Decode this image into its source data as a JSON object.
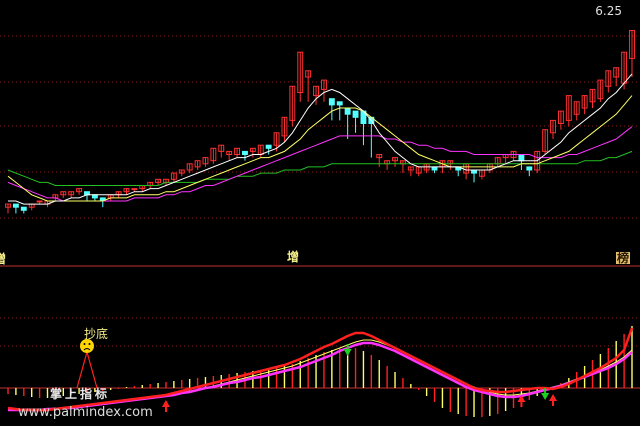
{
  "price_label": "6.25",
  "tags": {
    "left": "增",
    "mid": "增",
    "right": "榜"
  },
  "bottom_label": "掌上指标",
  "chaodi_label": "抄底",
  "watermark": "www.palmindex.com",
  "colors": {
    "up": "#ff3030",
    "down": "#54ffff",
    "ma_white": "#ffffff",
    "ma_yellow": "#ffff66",
    "ma_magenta": "#ff33ff",
    "ma_green": "#22c022",
    "signal_red": "#ff2020",
    "signal_yellow": "#ffff66",
    "signal_magenta": "#ff33ff",
    "grid": "#8a1a1a",
    "divider": "#c03030"
  },
  "chart_data": [
    {
      "type": "candlestick",
      "title": "",
      "ylim": [
        5.6,
        6.3
      ],
      "grid": true,
      "candles": [
        [
          5.68,
          5.69,
          5.66,
          5.67
        ],
        [
          5.69,
          5.68,
          5.66,
          5.69
        ],
        [
          5.68,
          5.67,
          5.66,
          5.68
        ],
        [
          5.68,
          5.69,
          5.67,
          5.67
        ],
        [
          5.7,
          5.7,
          5.69,
          5.7
        ],
        [
          5.69,
          5.7,
          5.68,
          5.7
        ],
        [
          5.71,
          5.72,
          5.7,
          5.71
        ],
        [
          5.72,
          5.73,
          5.71,
          5.72
        ],
        [
          5.72,
          5.73,
          5.71,
          5.73
        ],
        [
          5.73,
          5.74,
          5.72,
          5.73
        ],
        [
          5.73,
          5.72,
          5.7,
          5.73
        ],
        [
          5.72,
          5.71,
          5.7,
          5.72
        ],
        [
          5.71,
          5.7,
          5.68,
          5.71
        ],
        [
          5.71,
          5.72,
          5.7,
          5.72
        ],
        [
          5.72,
          5.73,
          5.71,
          5.73
        ],
        [
          5.73,
          5.74,
          5.72,
          5.73
        ],
        [
          5.74,
          5.74,
          5.73,
          5.74
        ],
        [
          5.74,
          5.75,
          5.73,
          5.75
        ],
        [
          5.75,
          5.76,
          5.74,
          5.76
        ],
        [
          5.76,
          5.77,
          5.75,
          5.76
        ],
        [
          5.76,
          5.77,
          5.75,
          5.77
        ],
        [
          5.77,
          5.79,
          5.76,
          5.79
        ],
        [
          5.79,
          5.8,
          5.78,
          5.8
        ],
        [
          5.8,
          5.82,
          5.79,
          5.81
        ],
        [
          5.81,
          5.83,
          5.8,
          5.82
        ],
        [
          5.82,
          5.84,
          5.81,
          5.83
        ],
        [
          5.83,
          5.87,
          5.82,
          5.86
        ],
        [
          5.86,
          5.88,
          5.84,
          5.85
        ],
        [
          5.85,
          5.86,
          5.83,
          5.85
        ],
        [
          5.85,
          5.87,
          5.84,
          5.86
        ],
        [
          5.86,
          5.85,
          5.83,
          5.86
        ],
        [
          5.86,
          5.87,
          5.84,
          5.85
        ],
        [
          5.85,
          5.88,
          5.84,
          5.88
        ],
        [
          5.88,
          5.87,
          5.85,
          5.88
        ],
        [
          5.88,
          5.92,
          5.86,
          5.91
        ],
        [
          5.91,
          5.97,
          5.89,
          5.96
        ],
        [
          5.96,
          6.07,
          5.94,
          6.05
        ],
        [
          6.05,
          6.18,
          6.02,
          6.1
        ],
        [
          6.1,
          6.12,
          6.02,
          6.04
        ],
        [
          6.04,
          6.07,
          6.01,
          6.06
        ],
        [
          6.06,
          6.09,
          6.02,
          6.03
        ],
        [
          6.03,
          6.01,
          5.96,
          6.02
        ],
        [
          6.02,
          6.01,
          5.96,
          6.0
        ],
        [
          6.0,
          5.98,
          5.9,
          5.99
        ],
        [
          5.99,
          5.97,
          5.92,
          5.99
        ],
        [
          5.99,
          5.95,
          5.88,
          5.97
        ],
        [
          5.97,
          5.95,
          5.84,
          5.84
        ],
        [
          5.84,
          5.85,
          5.81,
          5.82
        ],
        [
          5.82,
          5.83,
          5.8,
          5.83
        ],
        [
          5.83,
          5.84,
          5.81,
          5.82
        ],
        [
          5.82,
          5.83,
          5.79,
          5.8
        ],
        [
          5.8,
          5.81,
          5.78,
          5.79
        ],
        [
          5.79,
          5.81,
          5.78,
          5.8
        ],
        [
          5.8,
          5.82,
          5.79,
          5.81
        ],
        [
          5.81,
          5.8,
          5.79,
          5.81
        ],
        [
          5.81,
          5.83,
          5.79,
          5.82
        ],
        [
          5.82,
          5.83,
          5.8,
          5.81
        ],
        [
          5.81,
          5.8,
          5.78,
          5.79
        ],
        [
          5.79,
          5.82,
          5.77,
          5.8
        ],
        [
          5.8,
          5.79,
          5.76,
          5.78
        ],
        [
          5.78,
          5.8,
          5.77,
          5.8
        ],
        [
          5.8,
          5.82,
          5.79,
          5.82
        ],
        [
          5.82,
          5.84,
          5.81,
          5.84
        ],
        [
          5.84,
          5.85,
          5.82,
          5.84
        ],
        [
          5.84,
          5.86,
          5.83,
          5.85
        ],
        [
          5.85,
          5.83,
          5.8,
          5.81
        ],
        [
          5.81,
          5.8,
          5.78,
          5.8
        ],
        [
          5.8,
          5.86,
          5.79,
          5.86
        ],
        [
          5.86,
          5.93,
          5.85,
          5.92
        ],
        [
          5.92,
          5.96,
          5.9,
          5.95
        ],
        [
          5.95,
          5.99,
          5.93,
          5.96
        ],
        [
          5.96,
          6.04,
          5.94,
          5.98
        ],
        [
          5.98,
          6.02,
          5.96,
          6.0
        ],
        [
          6.0,
          6.04,
          5.98,
          6.02
        ],
        [
          6.02,
          6.06,
          6.0,
          6.03
        ],
        [
          6.03,
          6.09,
          6.02,
          6.07
        ],
        [
          6.07,
          6.12,
          6.05,
          6.1
        ],
        [
          6.1,
          6.13,
          6.07,
          6.08
        ],
        [
          6.08,
          6.18,
          6.06,
          6.16
        ],
        [
          6.16,
          6.25,
          6.1,
          6.18
        ]
      ],
      "ma_white": [
        5.7,
        5.7,
        5.69,
        5.69,
        5.69,
        5.69,
        5.7,
        5.7,
        5.71,
        5.71,
        5.72,
        5.72,
        5.72,
        5.72,
        5.72,
        5.72,
        5.73,
        5.73,
        5.74,
        5.74,
        5.75,
        5.76,
        5.77,
        5.78,
        5.79,
        5.8,
        5.81,
        5.82,
        5.83,
        5.84,
        5.84,
        5.85,
        5.85,
        5.86,
        5.87,
        5.89,
        5.92,
        5.96,
        6.0,
        6.03,
        6.05,
        6.06,
        6.05,
        6.03,
        6.01,
        5.99,
        5.96,
        5.92,
        5.89,
        5.86,
        5.84,
        5.82,
        5.81,
        5.81,
        5.81,
        5.81,
        5.81,
        5.81,
        5.8,
        5.8,
        5.8,
        5.8,
        5.81,
        5.82,
        5.83,
        5.83,
        5.83,
        5.83,
        5.85,
        5.87,
        5.89,
        5.92,
        5.94,
        5.96,
        5.98,
        6.0,
        6.03,
        6.05,
        6.08,
        6.11
      ],
      "ma_yellow": [
        5.78,
        5.76,
        5.74,
        5.72,
        5.71,
        5.7,
        5.7,
        5.7,
        5.7,
        5.7,
        5.7,
        5.7,
        5.7,
        5.71,
        5.71,
        5.71,
        5.72,
        5.72,
        5.72,
        5.72,
        5.73,
        5.73,
        5.74,
        5.75,
        5.76,
        5.77,
        5.78,
        5.79,
        5.8,
        5.81,
        5.82,
        5.83,
        5.84,
        5.84,
        5.85,
        5.86,
        5.88,
        5.9,
        5.93,
        5.95,
        5.97,
        5.99,
        6.0,
        6.0,
        6.0,
        5.99,
        5.97,
        5.95,
        5.93,
        5.91,
        5.89,
        5.87,
        5.85,
        5.84,
        5.83,
        5.82,
        5.81,
        5.81,
        5.81,
        5.81,
        5.81,
        5.81,
        5.81,
        5.81,
        5.81,
        5.82,
        5.82,
        5.82,
        5.83,
        5.84,
        5.85,
        5.86,
        5.88,
        5.9,
        5.92,
        5.94,
        5.96,
        5.98,
        6.01,
        6.04
      ],
      "ma_magenta": [
        5.76,
        5.75,
        5.74,
        5.73,
        5.72,
        5.71,
        5.71,
        5.7,
        5.7,
        5.7,
        5.7,
        5.7,
        5.7,
        5.7,
        5.7,
        5.7,
        5.71,
        5.71,
        5.71,
        5.71,
        5.72,
        5.72,
        5.73,
        5.73,
        5.74,
        5.75,
        5.75,
        5.76,
        5.77,
        5.78,
        5.79,
        5.8,
        5.81,
        5.82,
        5.83,
        5.84,
        5.85,
        5.86,
        5.87,
        5.88,
        5.89,
        5.9,
        5.91,
        5.91,
        5.91,
        5.91,
        5.91,
        5.91,
        5.9,
        5.9,
        5.89,
        5.89,
        5.88,
        5.88,
        5.87,
        5.87,
        5.86,
        5.86,
        5.86,
        5.85,
        5.85,
        5.85,
        5.85,
        5.85,
        5.85,
        5.85,
        5.85,
        5.84,
        5.84,
        5.84,
        5.84,
        5.85,
        5.85,
        5.86,
        5.87,
        5.88,
        5.89,
        5.9,
        5.92,
        5.94
      ],
      "ma_green": [
        5.8,
        5.79,
        5.78,
        5.77,
        5.76,
        5.76,
        5.75,
        5.75,
        5.75,
        5.75,
        5.75,
        5.75,
        5.75,
        5.75,
        5.75,
        5.75,
        5.75,
        5.75,
        5.75,
        5.75,
        5.76,
        5.76,
        5.76,
        5.76,
        5.76,
        5.77,
        5.77,
        5.77,
        5.77,
        5.78,
        5.78,
        5.78,
        5.79,
        5.79,
        5.79,
        5.8,
        5.8,
        5.8,
        5.81,
        5.81,
        5.81,
        5.82,
        5.82,
        5.82,
        5.82,
        5.82,
        5.82,
        5.82,
        5.82,
        5.82,
        5.82,
        5.82,
        5.82,
        5.82,
        5.82,
        5.82,
        5.82,
        5.82,
        5.82,
        5.82,
        5.82,
        5.82,
        5.82,
        5.82,
        5.82,
        5.82,
        5.82,
        5.82,
        5.82,
        5.82,
        5.82,
        5.82,
        5.82,
        5.83,
        5.83,
        5.83,
        5.84,
        5.84,
        5.85,
        5.86
      ]
    },
    {
      "type": "indicator",
      "title": "",
      "ylim": [
        -30,
        100
      ],
      "grid": true,
      "red_line": [
        -20,
        -21,
        -22,
        -22,
        -22,
        -22,
        -21,
        -20,
        -19,
        -18,
        -17,
        -16,
        -15,
        -14,
        -13,
        -12,
        -11,
        -10,
        -9,
        -8,
        -7,
        -5,
        -3,
        -1,
        1,
        3,
        5,
        7,
        9,
        11,
        13,
        15,
        17,
        19,
        21,
        23,
        26,
        29,
        33,
        37,
        41,
        44,
        48,
        52,
        55,
        55,
        52,
        48,
        44,
        40,
        36,
        32,
        28,
        24,
        20,
        16,
        12,
        8,
        4,
        0,
        -2,
        -3,
        -4,
        -4,
        -3,
        -2,
        -1,
        0,
        0,
        -1,
        1,
        4,
        8,
        12,
        16,
        20,
        25,
        30,
        38,
        60
      ],
      "magenta_line": [
        -22,
        -22,
        -22,
        -22,
        -22,
        -21,
        -21,
        -20,
        -20,
        -19,
        -18,
        -17,
        -16,
        -15,
        -14,
        -13,
        -12,
        -11,
        -10,
        -9,
        -8,
        -7,
        -5,
        -4,
        -2,
        0,
        1,
        3,
        5,
        6,
        8,
        10,
        11,
        13,
        15,
        17,
        19,
        21,
        24,
        27,
        30,
        33,
        37,
        40,
        43,
        45,
        45,
        43,
        40,
        37,
        33,
        29,
        25,
        21,
        17,
        13,
        9,
        5,
        1,
        -2,
        -4,
        -6,
        -8,
        -9,
        -9,
        -8,
        -6,
        -4,
        -2,
        0,
        2,
        5,
        8,
        11,
        14,
        17,
        20,
        24,
        29,
        36
      ],
      "yellow_line": [
        -21,
        -21,
        -21,
        -21,
        -21,
        -21,
        -20,
        -20,
        -19,
        -19,
        -18,
        -17,
        -16,
        -15,
        -14,
        -13,
        -12,
        -11,
        -10,
        -9,
        -8,
        -6,
        -5,
        -3,
        -2,
        0,
        2,
        4,
        6,
        8,
        10,
        12,
        14,
        16,
        18,
        20,
        22,
        25,
        28,
        31,
        34,
        37,
        40,
        43,
        46,
        48,
        48,
        46,
        43,
        40,
        36,
        32,
        28,
        24,
        20,
        16,
        12,
        8,
        4,
        1,
        -2,
        -4,
        -6,
        -7,
        -7,
        -6,
        -5,
        -3,
        -1,
        1,
        3,
        6,
        9,
        12,
        15,
        18,
        22,
        26,
        31,
        38
      ],
      "bars": [
        -6,
        -7,
        -8,
        -9,
        -10,
        -10,
        -9,
        -8,
        -7,
        -6,
        -5,
        -4,
        -3,
        -2,
        -1,
        1,
        2,
        3,
        4,
        5,
        6,
        7,
        8,
        9,
        10,
        11,
        12,
        13,
        14,
        15,
        16,
        17,
        18,
        19,
        20,
        22,
        24,
        27,
        30,
        33,
        36,
        38,
        40,
        41,
        40,
        37,
        33,
        28,
        22,
        16,
        10,
        4,
        -2,
        -8,
        -14,
        -20,
        -24,
        -26,
        -28,
        -29,
        -29,
        -28,
        -26,
        -23,
        -20,
        -16,
        -12,
        -8,
        -4,
        0,
        5,
        10,
        16,
        22,
        28,
        34,
        40,
        47,
        54,
        62
      ],
      "bar_colors": "positive and negative vertical bars alternate red/yellow",
      "signals": {
        "green_down_arrows": [
          43,
          68
        ],
        "red_up_arrows": [
          20,
          65,
          69
        ],
        "chaodi_index": 10
      }
    }
  ]
}
